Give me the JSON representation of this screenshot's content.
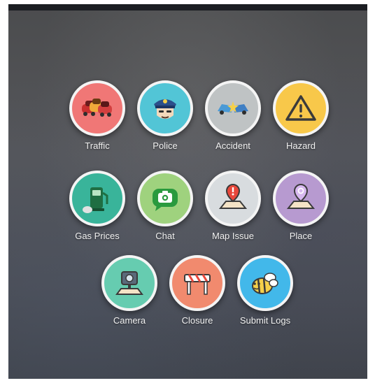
{
  "menu": {
    "row1": [
      {
        "label": "Traffic",
        "icon": "traffic-icon",
        "color": "#f07776"
      },
      {
        "label": "Police",
        "icon": "police-icon",
        "color": "#52c5d6"
      },
      {
        "label": "Accident",
        "icon": "accident-icon",
        "color": "#bfc3c4"
      },
      {
        "label": "Hazard",
        "icon": "hazard-icon",
        "color": "#f8c84a"
      }
    ],
    "row2": [
      {
        "label": "Gas Prices",
        "icon": "gas-pump-icon",
        "color": "#39b49a"
      },
      {
        "label": "Chat",
        "icon": "camera-chat-icon",
        "color": "#9fd27e"
      },
      {
        "label": "Map Issue",
        "icon": "map-issue-icon",
        "color": "#d8dcdf"
      },
      {
        "label": "Place",
        "icon": "place-icon",
        "color": "#b79ad0"
      }
    ],
    "row3": [
      {
        "label": "Camera",
        "icon": "speed-camera-icon",
        "color": "#66ccb0"
      },
      {
        "label": "Closure",
        "icon": "road-closure-icon",
        "color": "#f18a6e"
      },
      {
        "label": "Submit Logs",
        "icon": "bee-icon",
        "color": "#42b8ea"
      }
    ]
  }
}
